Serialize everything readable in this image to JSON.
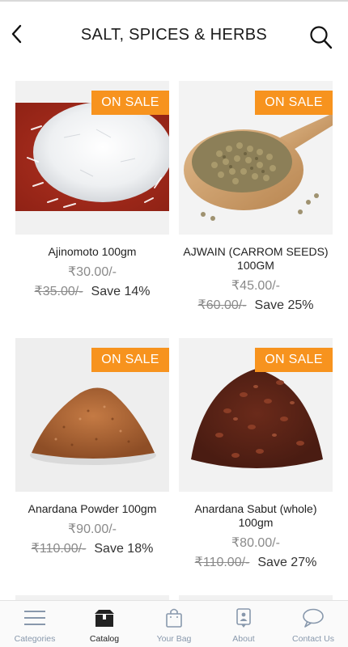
{
  "header": {
    "title": "SALT, SPICES & HERBS",
    "back_icon": "back-arrow-icon",
    "search_icon": "search-icon"
  },
  "products": [
    {
      "name": "Ajinomoto 100gm",
      "price": "₹30.00/-",
      "old_price": "₹35.00/-",
      "save": "Save 14%",
      "badge": "ON SALE"
    },
    {
      "name": "AJWAIN (CARROM SEEDS) 100GM",
      "price": "₹45.00/-",
      "old_price": "₹60.00/-",
      "save": "Save 25%",
      "badge": "ON SALE"
    },
    {
      "name": "Anardana Powder 100gm",
      "price": "₹90.00/-",
      "old_price": "₹110.00/-",
      "save": "Save 18%",
      "badge": "ON SALE"
    },
    {
      "name": "Anardana Sabut (whole) 100gm",
      "price": "₹80.00/-",
      "old_price": "₹110.00/-",
      "save": "Save 27%",
      "badge": "ON SALE"
    }
  ],
  "tabbar": {
    "items": [
      {
        "label": "Categories",
        "icon": "menu-lines-icon"
      },
      {
        "label": "Catalog",
        "icon": "box-icon"
      },
      {
        "label": "Your Bag",
        "icon": "shopping-bag-icon"
      },
      {
        "label": "About",
        "icon": "about-info-icon"
      },
      {
        "label": "Contact Us",
        "icon": "chat-bubble-icon"
      }
    ],
    "active_index": 1
  },
  "colors": {
    "badge": "#f7931e",
    "inactive_tab": "#8898ac",
    "price": "#8a8a8a"
  }
}
